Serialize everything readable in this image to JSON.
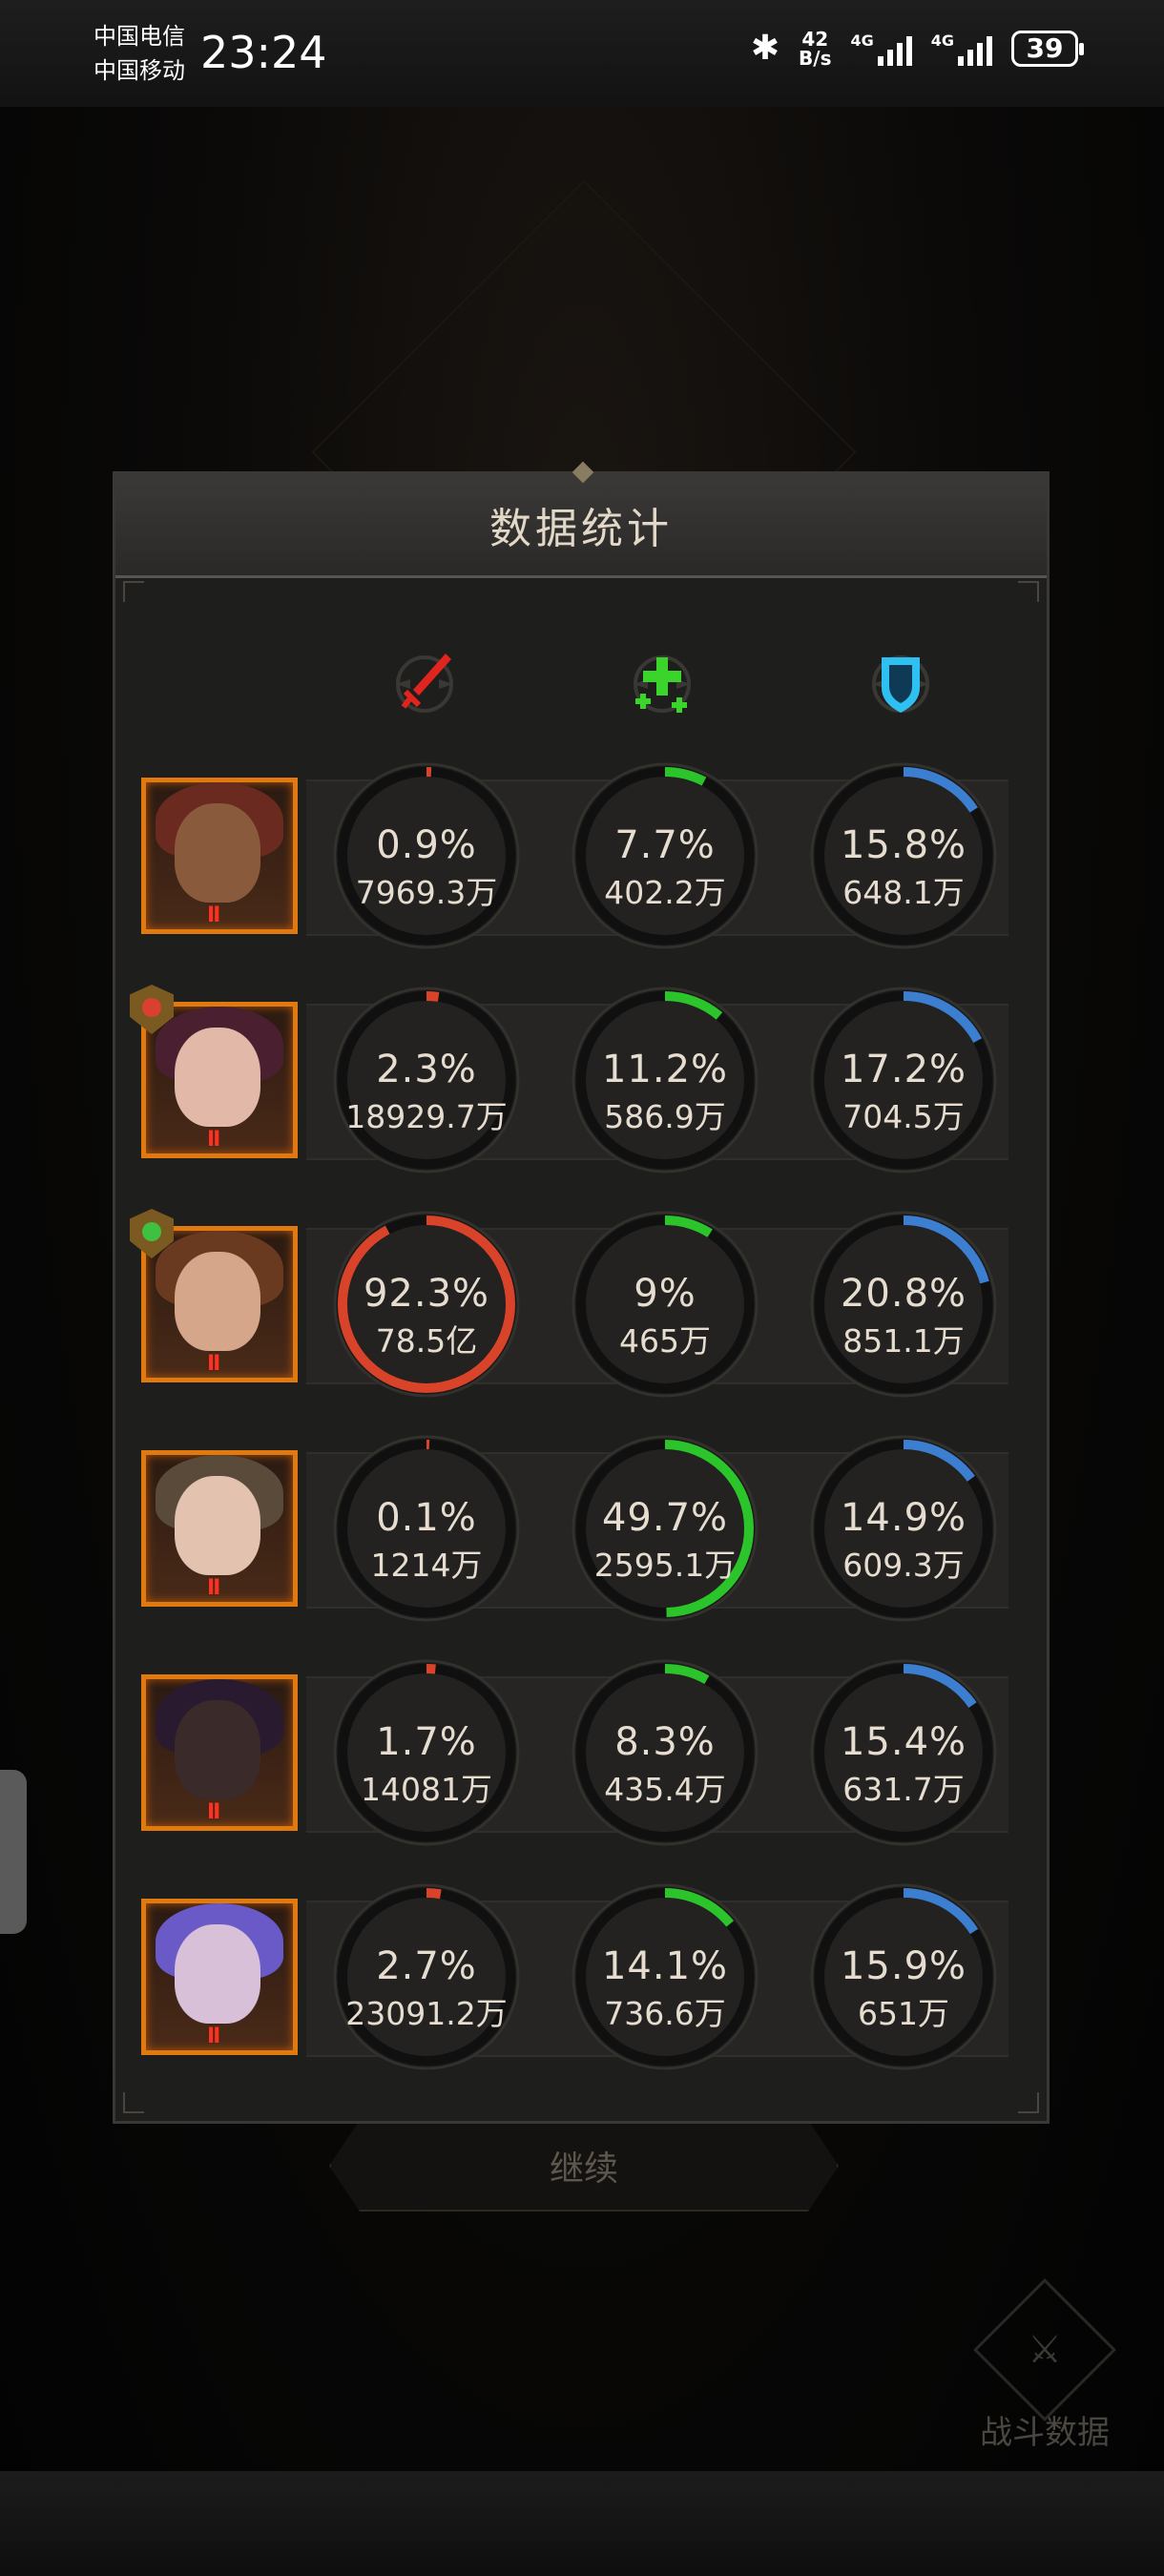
{
  "status_bar": {
    "carrier1": "中国电信",
    "carrier2": "中国移动",
    "time": "23:24",
    "speed_value": "42",
    "speed_unit": "B/s",
    "net1": "4G",
    "net2": "4G",
    "battery": "39"
  },
  "dialog": {
    "title": "数据统计",
    "categories": [
      {
        "icon": "sword-icon",
        "color": "#e0251f"
      },
      {
        "icon": "healing-cross-icon",
        "color": "#3bd42a"
      },
      {
        "icon": "shield-icon",
        "color": "#2ec0f0"
      }
    ],
    "heroes": [
      {
        "rank": "II",
        "badge": "",
        "stats": [
          {
            "percent": "0.9%",
            "amount": "7969.3万",
            "fraction": 0.009
          },
          {
            "percent": "7.7%",
            "amount": "402.2万",
            "fraction": 0.077
          },
          {
            "percent": "15.8%",
            "amount": "648.1万",
            "fraction": 0.158
          }
        ]
      },
      {
        "rank": "II",
        "badge": "red",
        "stats": [
          {
            "percent": "2.3%",
            "amount": "18929.7万",
            "fraction": 0.023
          },
          {
            "percent": "11.2%",
            "amount": "586.9万",
            "fraction": 0.112
          },
          {
            "percent": "17.2%",
            "amount": "704.5万",
            "fraction": 0.172
          }
        ]
      },
      {
        "rank": "II",
        "badge": "green",
        "stats": [
          {
            "percent": "92.3%",
            "amount": "78.5亿",
            "fraction": 0.923
          },
          {
            "percent": "9%",
            "amount": "465万",
            "fraction": 0.09
          },
          {
            "percent": "20.8%",
            "amount": "851.1万",
            "fraction": 0.208
          }
        ]
      },
      {
        "rank": "II",
        "badge": "",
        "stats": [
          {
            "percent": "0.1%",
            "amount": "1214万",
            "fraction": 0.001
          },
          {
            "percent": "49.7%",
            "amount": "2595.1万",
            "fraction": 0.497
          },
          {
            "percent": "14.9%",
            "amount": "609.3万",
            "fraction": 0.149
          }
        ]
      },
      {
        "rank": "II",
        "badge": "",
        "stats": [
          {
            "percent": "1.7%",
            "amount": "14081万",
            "fraction": 0.017
          },
          {
            "percent": "8.3%",
            "amount": "435.4万",
            "fraction": 0.083
          },
          {
            "percent": "15.4%",
            "amount": "631.7万",
            "fraction": 0.154
          }
        ]
      },
      {
        "rank": "II",
        "badge": "",
        "stats": [
          {
            "percent": "2.7%",
            "amount": "23091.2万",
            "fraction": 0.027
          },
          {
            "percent": "14.1%",
            "amount": "736.6万",
            "fraction": 0.141
          },
          {
            "percent": "15.9%",
            "amount": "651万",
            "fraction": 0.159
          }
        ]
      }
    ]
  },
  "continue_label": "继续",
  "battle_data_label": "战斗数据",
  "colors": {
    "damage": "#d9432a",
    "heal": "#2bc42b",
    "tank": "#3c7fd0",
    "track": "#101010",
    "portrait_border": "#e07a10"
  }
}
